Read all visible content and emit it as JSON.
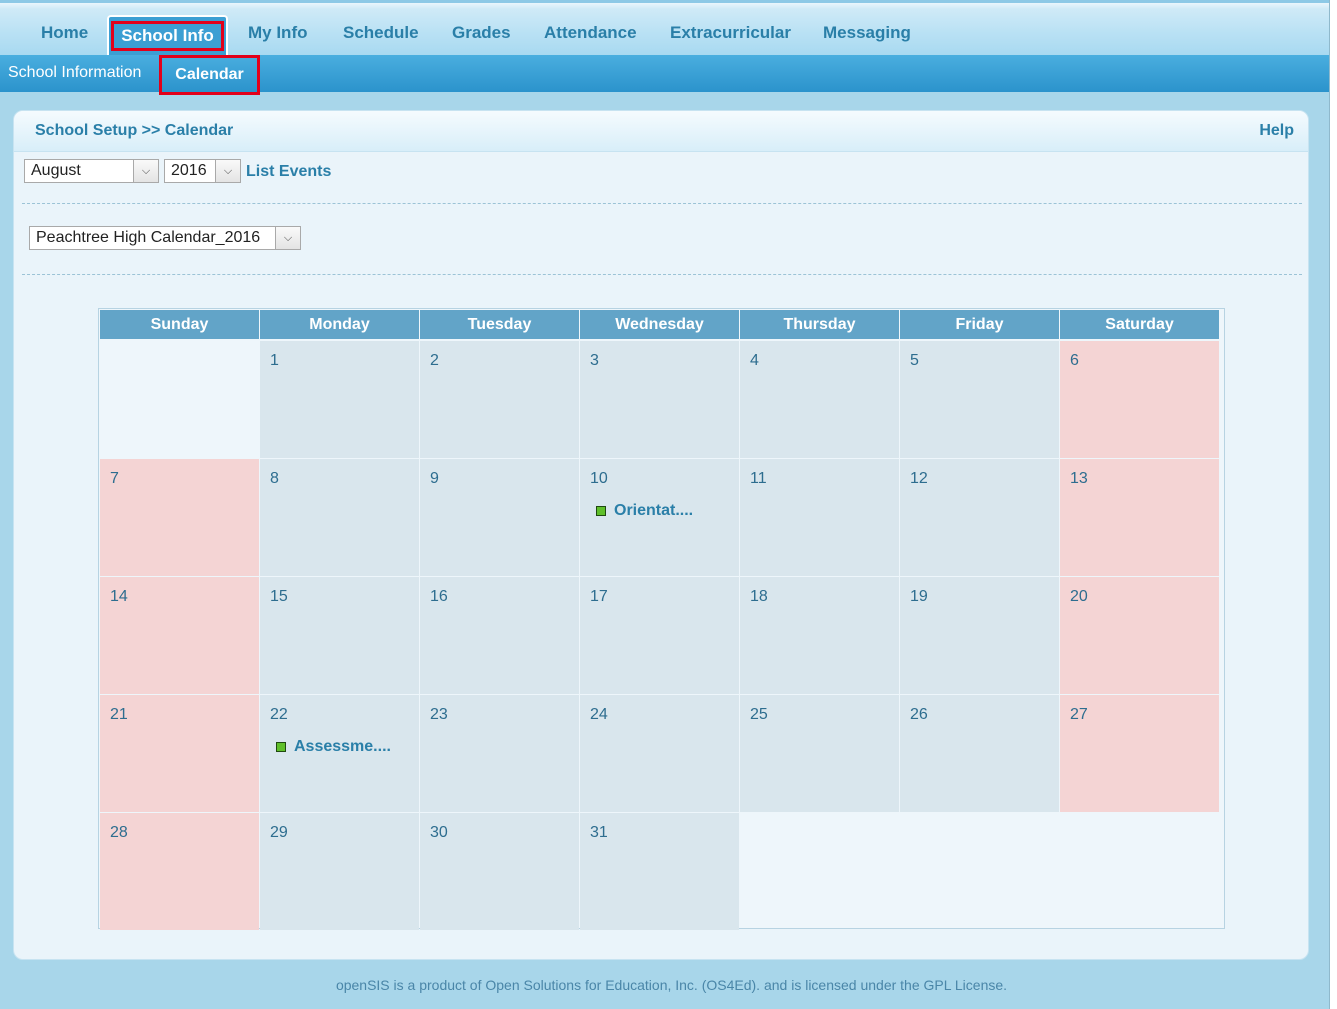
{
  "topnav": {
    "tabs": [
      {
        "label": "Home"
      },
      {
        "label": "School Info",
        "active": true
      },
      {
        "label": "My Info"
      },
      {
        "label": "Schedule"
      },
      {
        "label": "Grades"
      },
      {
        "label": "Attendance"
      },
      {
        "label": "Extracurricular"
      },
      {
        "label": "Messaging"
      }
    ]
  },
  "subnav": {
    "items": [
      {
        "label": "School Information"
      },
      {
        "label": "Calendar",
        "active": true
      }
    ]
  },
  "panel": {
    "title": "School Setup >> Calendar",
    "help": "Help"
  },
  "filters": {
    "month": "August",
    "year": "2016",
    "list_events": "List Events",
    "calendar_name": "Peachtree High Calendar_2016"
  },
  "calendar": {
    "days_of_week": [
      "Sunday",
      "Monday",
      "Tuesday",
      "Wednesday",
      "Thursday",
      "Friday",
      "Saturday"
    ],
    "weeks": [
      [
        {
          "day": ""
        },
        {
          "day": "1"
        },
        {
          "day": "2"
        },
        {
          "day": "3"
        },
        {
          "day": "4"
        },
        {
          "day": "5"
        },
        {
          "day": "6"
        }
      ],
      [
        {
          "day": "7"
        },
        {
          "day": "8"
        },
        {
          "day": "9"
        },
        {
          "day": "10",
          "event": "Orientat...."
        },
        {
          "day": "11"
        },
        {
          "day": "12"
        },
        {
          "day": "13"
        }
      ],
      [
        {
          "day": "14"
        },
        {
          "day": "15"
        },
        {
          "day": "16"
        },
        {
          "day": "17"
        },
        {
          "day": "18"
        },
        {
          "day": "19"
        },
        {
          "day": "20"
        }
      ],
      [
        {
          "day": "21"
        },
        {
          "day": "22",
          "event": "Assessme...."
        },
        {
          "day": "23"
        },
        {
          "day": "24"
        },
        {
          "day": "25"
        },
        {
          "day": "26"
        },
        {
          "day": "27"
        }
      ],
      [
        {
          "day": "28"
        },
        {
          "day": "29"
        },
        {
          "day": "30"
        },
        {
          "day": "31"
        },
        {
          "day": ""
        },
        {
          "day": ""
        },
        {
          "day": ""
        }
      ]
    ],
    "colors": {
      "weekday": "#d9e6ed",
      "weekend": "#f4d4d4",
      "event_dot": "#5fbf2a"
    }
  },
  "footer": {
    "text": "openSIS is a product of Open Solutions for Education, Inc. (OS4Ed). and is licensed under the GPL License."
  }
}
